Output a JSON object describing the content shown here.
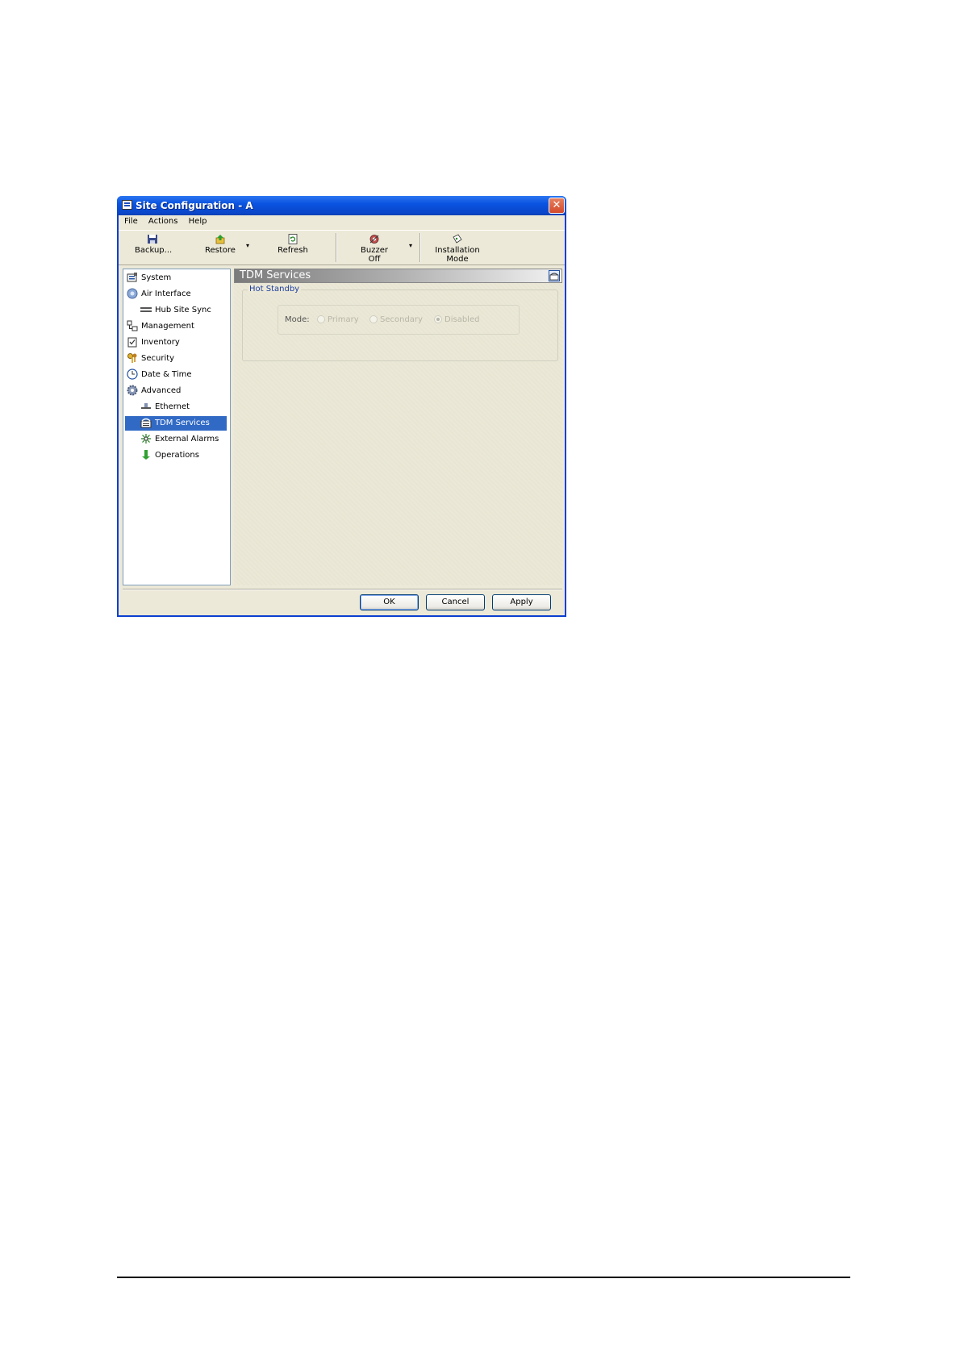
{
  "window": {
    "title": "Site Configuration - A",
    "close_glyph": "✕"
  },
  "menu": [
    "File",
    "Actions",
    "Help"
  ],
  "toolbar": {
    "backup": "Backup...",
    "restore": "Restore",
    "refresh": "Refresh",
    "buzzer_off": "Buzzer Off",
    "installation_mode": "Installation Mode",
    "dropdown_glyph": "▾"
  },
  "tree": {
    "system": "System",
    "air_interface": "Air Interface",
    "hub_site_sync": "Hub Site Sync",
    "management": "Management",
    "inventory": "Inventory",
    "security": "Security",
    "date_time": "Date & Time",
    "advanced": "Advanced",
    "ethernet": "Ethernet",
    "tdm_services": "TDM Services",
    "external_alarms": "External Alarms",
    "operations": "Operations",
    "selected": "TDM Services"
  },
  "panel": {
    "title": "TDM Services",
    "group_title": "Hot Standby",
    "mode_label": "Mode:",
    "options": [
      "Primary",
      "Secondary",
      "Disabled"
    ],
    "selected_option": "Disabled"
  },
  "buttons": {
    "ok": "OK",
    "cancel": "Cancel",
    "apply": "Apply"
  },
  "colors": {
    "titlebar": "#0a53e1",
    "selection": "#316ac5",
    "group_title": "#2040a0"
  }
}
